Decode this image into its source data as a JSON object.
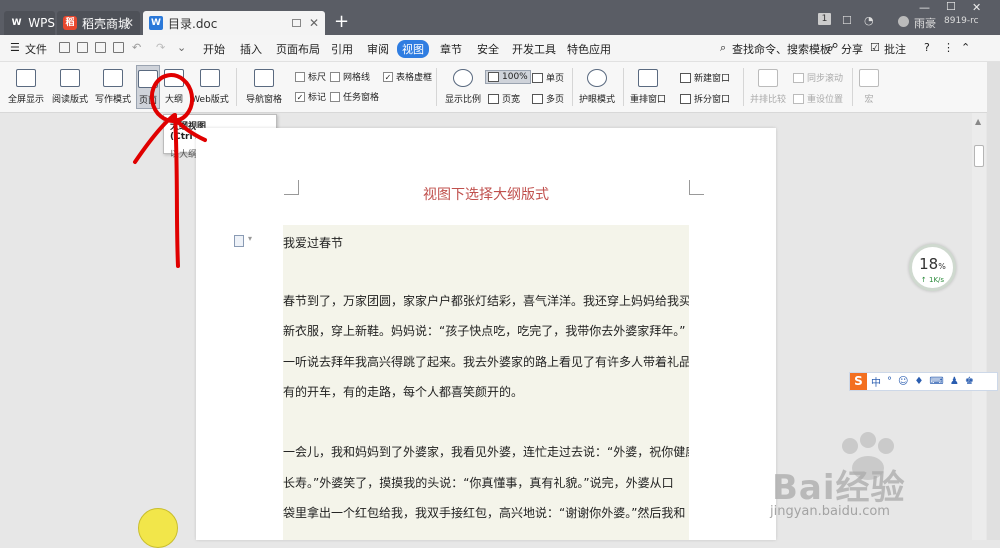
{
  "titlebar": {
    "tabs": [
      {
        "label": "WPS"
      },
      {
        "label": "稻壳商城"
      },
      {
        "label": "目录.doc"
      }
    ],
    "user_name": "雨豪",
    "user_id": "8919-rc",
    "page_badge": "1"
  },
  "menubar": {
    "file": "文件",
    "items": [
      "开始",
      "插入",
      "页面布局",
      "引用",
      "审阅",
      "视图",
      "章节",
      "安全",
      "开发工具",
      "特色应用"
    ],
    "search": "查找命令、搜索模板",
    "share": "分享",
    "comment": "批注",
    "help": "?"
  },
  "ribbon": {
    "fullscreen": "全屏显示",
    "reading": "阅读版式",
    "writing": "写作模式",
    "page": "页面",
    "outline": "大纲",
    "web": "Web版式",
    "nav": "导航窗格",
    "ruler": "标尺",
    "gridlines": "网格线",
    "table_border": "表格虚框",
    "marks": "标记",
    "task_pane": "任务窗格",
    "zoom_ratio": "显示比例",
    "zoom_100": "100%",
    "page_width": "页宽",
    "single_page": "单页",
    "multi_page": "多页",
    "eye_mode": "护眼模式",
    "rearrange": "重排窗口",
    "new_window": "新建窗口",
    "split_window": "拆分窗口",
    "side_by_side": "并排比较",
    "sync_scroll": "同步滚动",
    "reset_position": "重设位置",
    "macro": "宏"
  },
  "tooltip": {
    "title": "大纲视图 (Ctrl+Alt+O)",
    "desc": "以大纲形式查看文档。"
  },
  "document": {
    "title": "视图下选择大纲版式",
    "paragraphs": [
      "我爱过春节",
      "春节到了，万家团圆，家家户户都张灯结彩，喜气洋洋。我还穿上妈妈给我买的",
      "新衣服，穿上新鞋。妈妈说：“孩子快点吃，吃完了，我带你去外婆家拜年。”",
      "一听说去拜年我高兴得跳了起来。我去外婆家的路上看见了有许多人带着礼品，",
      "有的开车，有的走路，每个人都喜笑颜开的。",
      "一会儿，我和妈妈到了外婆家，我看见外婆，连忙走过去说：“外婆，祝你健康",
      "长寿。”外婆笑了，摸摸我的头说：“你真懂事，真有礼貌。”说完，外婆从口",
      "袋里拿出一个红包给我，我双手接红包，高兴地说：“谢谢你外婆。”然后我和"
    ]
  },
  "speed_widget": {
    "percent": "18",
    "unit": "%",
    "rate": "↑ 1K/s"
  },
  "ime": {
    "items": [
      "中",
      "°",
      "☺",
      "♦",
      "⌨",
      "♟",
      "♚"
    ]
  },
  "watermark": {
    "text": "Bai经验",
    "url": "jingyan.baidu.com"
  },
  "colors": {
    "titlebar": "#5a5d65",
    "accent": "#2f7de1",
    "doc_title": "#c0504d",
    "annotation": "#e00000"
  }
}
